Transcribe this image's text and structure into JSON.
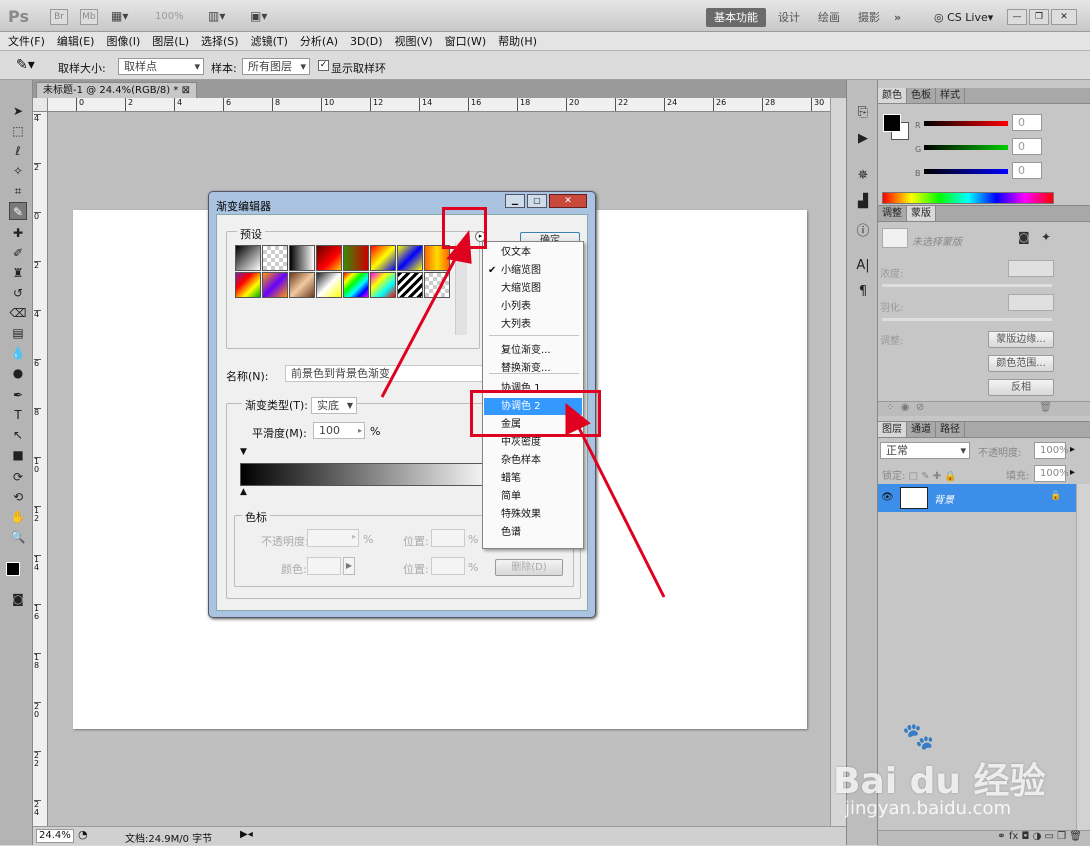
{
  "app": {
    "logo": "Ps",
    "zoom": "100%",
    "workspaces": [
      "基本功能",
      "设计",
      "绘画",
      "摄影"
    ],
    "more": "»",
    "cslive": "CS Live",
    "window_buttons": [
      "—",
      "❐",
      "✕"
    ]
  },
  "menu": [
    "文件(F)",
    "编辑(E)",
    "图像(I)",
    "图层(L)",
    "选择(S)",
    "滤镜(T)",
    "分析(A)",
    "3D(D)",
    "视图(V)",
    "窗口(W)",
    "帮助(H)"
  ],
  "options": {
    "sample_size_label": "取样大小:",
    "sample_size_value": "取样点",
    "sample_label": "样本:",
    "sample_value": "所有图层",
    "show_ring_label": "显示取样环",
    "show_ring_checked": true
  },
  "document": {
    "tab": "未标题-1 @ 24.4%(RGB/8) *",
    "ruler_h": [
      "0",
      "2",
      "4",
      "6",
      "8",
      "10",
      "12",
      "14",
      "16",
      "18",
      "20",
      "22",
      "24",
      "26",
      "28",
      "30"
    ],
    "ruler_v": [
      "4",
      "2",
      "0",
      "2",
      "4",
      "6",
      "8",
      "1 0",
      "1 2",
      "1 4",
      "1 6",
      "1 8",
      "2 0",
      "2 2",
      "2 4"
    ]
  },
  "status": {
    "zoom": "24.4%",
    "doc": "文档:24.9M/0 字节"
  },
  "color_panel": {
    "tabs": [
      "颜色",
      "色板",
      "样式"
    ],
    "channels": [
      {
        "label": "R",
        "value": "0"
      },
      {
        "label": "G",
        "value": "0"
      },
      {
        "label": "B",
        "value": "0"
      }
    ]
  },
  "adjust_panel": {
    "tabs": [
      "调整",
      "蒙版"
    ],
    "placeholder": "未选择蒙版",
    "density_label": "浓度:",
    "feather_label": "羽化:",
    "refine_label": "调整:",
    "buttons": [
      "蒙版边缘...",
      "颜色范围...",
      "反相"
    ]
  },
  "layers_panel": {
    "tabs": [
      "图层",
      "通道",
      "路径"
    ],
    "blend_mode": "正常",
    "opacity_label": "不透明度:",
    "opacity": "100%",
    "lock_label": "锁定:",
    "fill_label": "填充:",
    "fill": "100%",
    "layer_name": "背景"
  },
  "dialog": {
    "title": "渐变编辑器",
    "presets_label": "预设",
    "ok_label": "确定",
    "name_label": "名称(N):",
    "name_value": "前景色到背景色渐变",
    "type_label": "渐变类型(T):",
    "type_value": "实底",
    "smooth_label": "平滑度(M):",
    "smooth_value": "100",
    "percent": "%",
    "stops_label": "色标",
    "opacity_label": "不透明度:",
    "position_label": "位置:",
    "color_label": "颜色:",
    "delete_label": "删除(D)"
  },
  "context_menu": {
    "items": [
      {
        "label": "仅文本",
        "checked": false
      },
      {
        "label": "小缩览图",
        "checked": true
      },
      {
        "label": "大缩览图",
        "checked": false
      },
      {
        "label": "小列表",
        "checked": false
      },
      {
        "label": "大列表",
        "checked": false
      },
      {
        "label": "复位渐变...",
        "checked": false
      },
      {
        "label": "替换渐变...",
        "checked": false
      },
      {
        "label": "协调色 1",
        "checked": false
      },
      {
        "label": "协调色 2",
        "checked": false,
        "highlighted": true
      },
      {
        "label": "金属",
        "checked": false
      },
      {
        "label": "中灰密度",
        "checked": false
      },
      {
        "label": "杂色样本",
        "checked": false
      },
      {
        "label": "蜡笔",
        "checked": false
      },
      {
        "label": "简单",
        "checked": false
      },
      {
        "label": "特殊效果",
        "checked": false
      },
      {
        "label": "色谱",
        "checked": false
      }
    ]
  },
  "watermark": {
    "brand": "Bai du 经验",
    "url": "jingyan.baidu.com"
  },
  "colors": {
    "annotation_red": "#e00020",
    "highlight_blue": "#3399ff"
  }
}
